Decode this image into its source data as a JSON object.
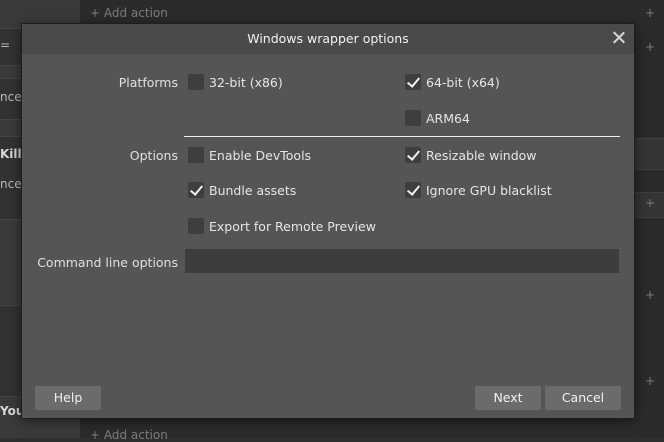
{
  "background": {
    "left_fragments": [
      "=",
      "nce",
      "Kille",
      "nce",
      "Your"
    ],
    "add_action_label": "+ Add action",
    "edge_plus": "+"
  },
  "dialog": {
    "title": "Windows wrapper options",
    "platforms": {
      "label": "Platforms",
      "options": [
        {
          "label": "32-bit (x86)",
          "checked": false
        },
        {
          "label": "64-bit (x64)",
          "checked": true
        },
        {
          "label": "ARM64",
          "checked": false
        }
      ]
    },
    "options": {
      "label": "Options",
      "items": [
        {
          "label": "Enable DevTools",
          "checked": false
        },
        {
          "label": "Resizable window",
          "checked": true
        },
        {
          "label": "Bundle assets",
          "checked": true
        },
        {
          "label": "Ignore GPU blacklist",
          "checked": true
        },
        {
          "label": "Export for Remote Preview",
          "checked": false
        }
      ]
    },
    "command_line": {
      "label": "Command line options",
      "value": ""
    },
    "buttons": {
      "help": "Help",
      "next": "Next",
      "cancel": "Cancel"
    }
  },
  "colors": {
    "dialog_bg": "#555555",
    "titlebar_bg": "#4a4a4a",
    "button_bg": "#6b6b6b",
    "checkbox_bg": "#3e3e3e"
  }
}
